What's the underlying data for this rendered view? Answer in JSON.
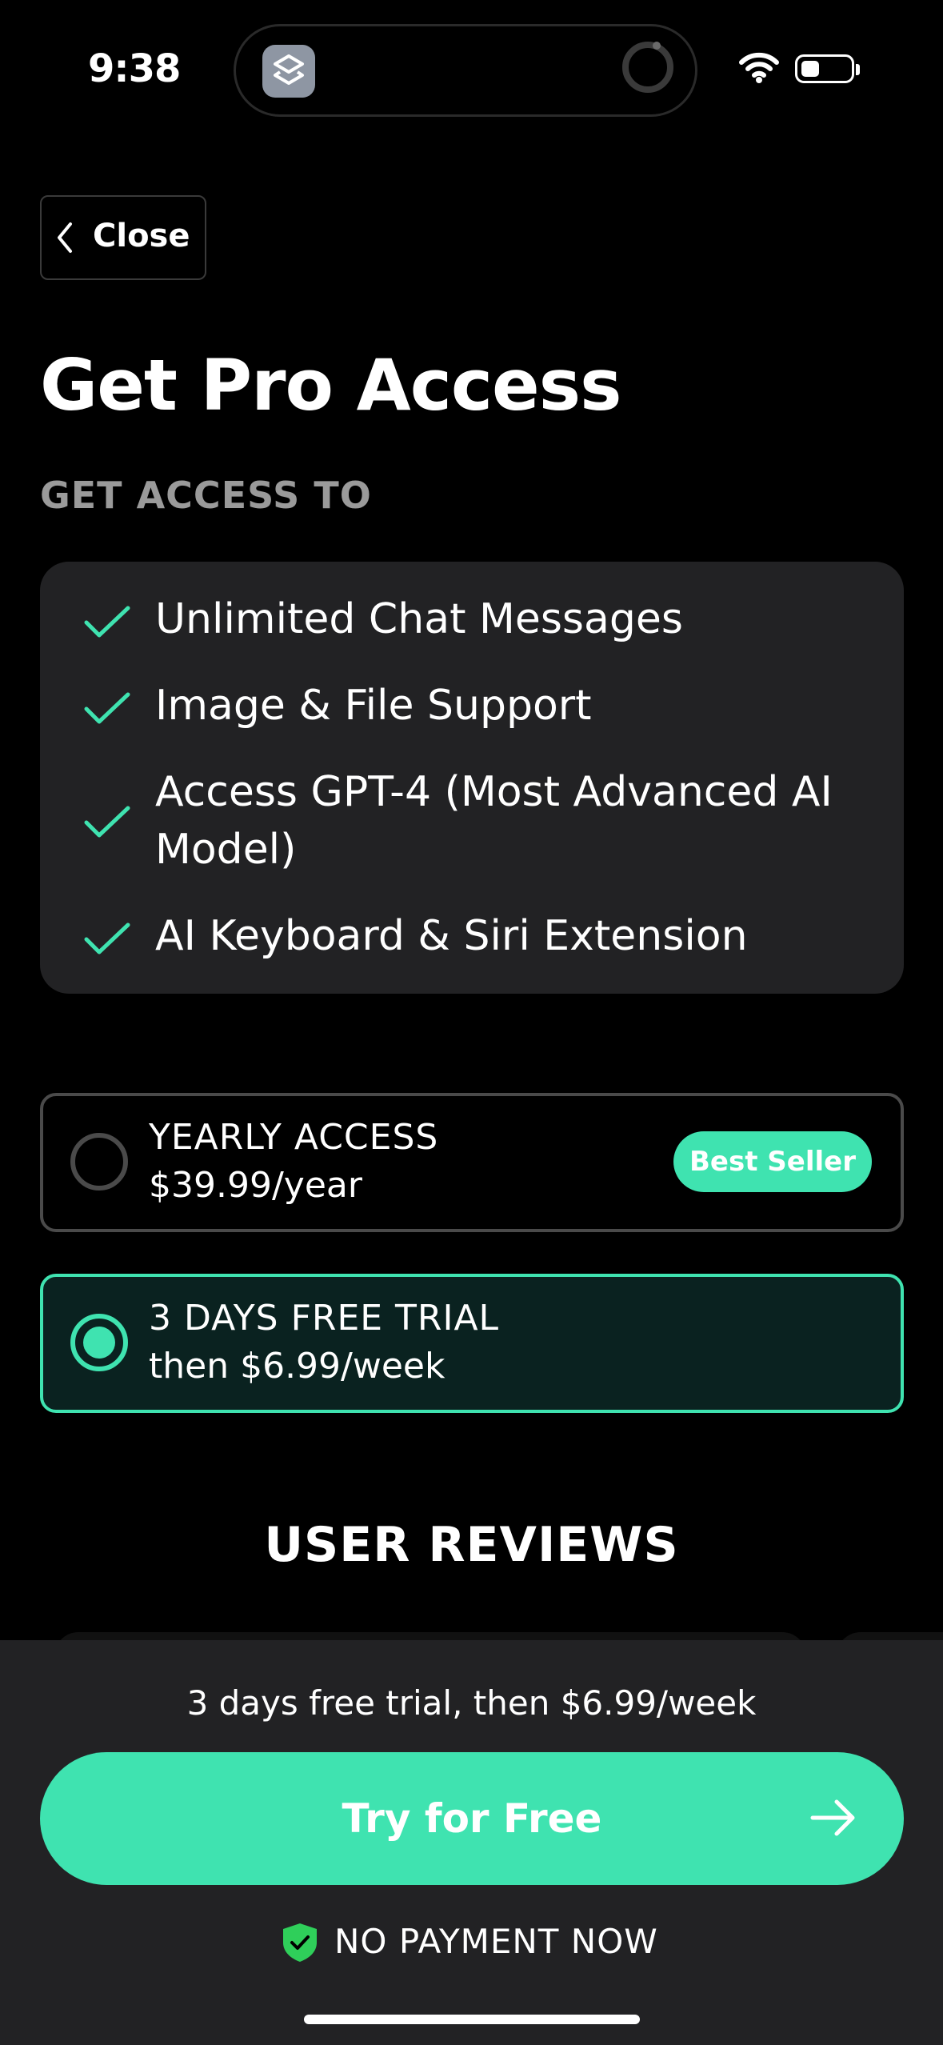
{
  "status_bar": {
    "time": "9:38",
    "icons": [
      "shortcuts-app-icon",
      "activity-ring-icon",
      "wifi-icon",
      "battery-icon"
    ]
  },
  "header": {
    "close_label": "Close",
    "title": "Get Pro Access",
    "subtitle": "GET ACCESS TO"
  },
  "features": [
    "Unlimited Chat Messages",
    "Image & File Support",
    "Access GPT-4 (Most Advanced AI Model)",
    "AI Keyboard & Siri Extension"
  ],
  "plans": [
    {
      "name": "YEARLY ACCESS",
      "price": "$39.99/year",
      "badge": "Best Seller",
      "selected": false
    },
    {
      "name": "3 DAYS FREE TRIAL",
      "price": "then $6.99/week",
      "selected": true
    }
  ],
  "reviews_title": "USER REVIEWS",
  "footer": {
    "info": "3 days free trial, then $6.99/week",
    "cta_label": "Try for Free",
    "no_payment": "NO PAYMENT NOW"
  },
  "colors": {
    "accent": "#3fe3b0",
    "panel": "#222224",
    "background": "#000000"
  }
}
